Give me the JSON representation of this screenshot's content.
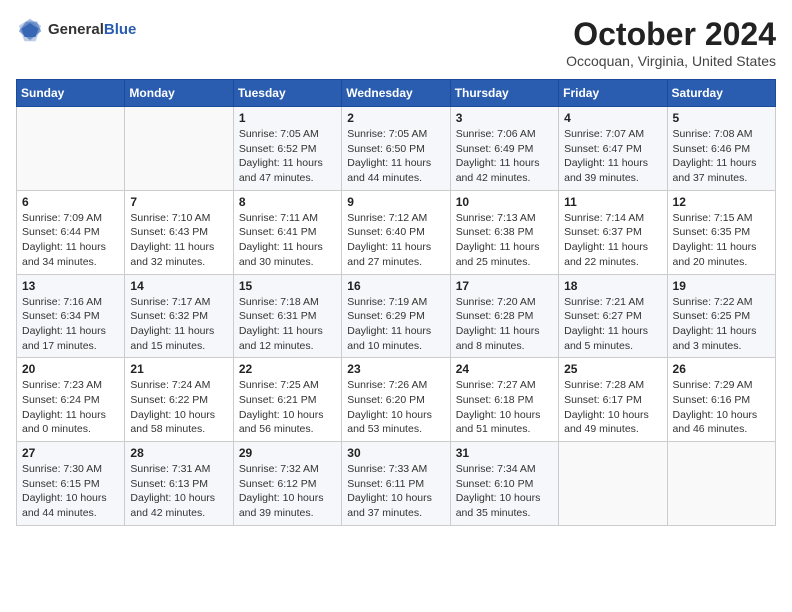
{
  "header": {
    "logo": {
      "text_general": "General",
      "text_blue": "Blue"
    },
    "month": "October 2024",
    "location": "Occoquan, Virginia, United States"
  },
  "weekdays": [
    "Sunday",
    "Monday",
    "Tuesday",
    "Wednesday",
    "Thursday",
    "Friday",
    "Saturday"
  ],
  "weeks": [
    [
      {
        "day": "",
        "info": ""
      },
      {
        "day": "",
        "info": ""
      },
      {
        "day": "1",
        "info": "Sunrise: 7:05 AM\nSunset: 6:52 PM\nDaylight: 11 hours and 47 minutes."
      },
      {
        "day": "2",
        "info": "Sunrise: 7:05 AM\nSunset: 6:50 PM\nDaylight: 11 hours and 44 minutes."
      },
      {
        "day": "3",
        "info": "Sunrise: 7:06 AM\nSunset: 6:49 PM\nDaylight: 11 hours and 42 minutes."
      },
      {
        "day": "4",
        "info": "Sunrise: 7:07 AM\nSunset: 6:47 PM\nDaylight: 11 hours and 39 minutes."
      },
      {
        "day": "5",
        "info": "Sunrise: 7:08 AM\nSunset: 6:46 PM\nDaylight: 11 hours and 37 minutes."
      }
    ],
    [
      {
        "day": "6",
        "info": "Sunrise: 7:09 AM\nSunset: 6:44 PM\nDaylight: 11 hours and 34 minutes."
      },
      {
        "day": "7",
        "info": "Sunrise: 7:10 AM\nSunset: 6:43 PM\nDaylight: 11 hours and 32 minutes."
      },
      {
        "day": "8",
        "info": "Sunrise: 7:11 AM\nSunset: 6:41 PM\nDaylight: 11 hours and 30 minutes."
      },
      {
        "day": "9",
        "info": "Sunrise: 7:12 AM\nSunset: 6:40 PM\nDaylight: 11 hours and 27 minutes."
      },
      {
        "day": "10",
        "info": "Sunrise: 7:13 AM\nSunset: 6:38 PM\nDaylight: 11 hours and 25 minutes."
      },
      {
        "day": "11",
        "info": "Sunrise: 7:14 AM\nSunset: 6:37 PM\nDaylight: 11 hours and 22 minutes."
      },
      {
        "day": "12",
        "info": "Sunrise: 7:15 AM\nSunset: 6:35 PM\nDaylight: 11 hours and 20 minutes."
      }
    ],
    [
      {
        "day": "13",
        "info": "Sunrise: 7:16 AM\nSunset: 6:34 PM\nDaylight: 11 hours and 17 minutes."
      },
      {
        "day": "14",
        "info": "Sunrise: 7:17 AM\nSunset: 6:32 PM\nDaylight: 11 hours and 15 minutes."
      },
      {
        "day": "15",
        "info": "Sunrise: 7:18 AM\nSunset: 6:31 PM\nDaylight: 11 hours and 12 minutes."
      },
      {
        "day": "16",
        "info": "Sunrise: 7:19 AM\nSunset: 6:29 PM\nDaylight: 11 hours and 10 minutes."
      },
      {
        "day": "17",
        "info": "Sunrise: 7:20 AM\nSunset: 6:28 PM\nDaylight: 11 hours and 8 minutes."
      },
      {
        "day": "18",
        "info": "Sunrise: 7:21 AM\nSunset: 6:27 PM\nDaylight: 11 hours and 5 minutes."
      },
      {
        "day": "19",
        "info": "Sunrise: 7:22 AM\nSunset: 6:25 PM\nDaylight: 11 hours and 3 minutes."
      }
    ],
    [
      {
        "day": "20",
        "info": "Sunrise: 7:23 AM\nSunset: 6:24 PM\nDaylight: 11 hours and 0 minutes."
      },
      {
        "day": "21",
        "info": "Sunrise: 7:24 AM\nSunset: 6:22 PM\nDaylight: 10 hours and 58 minutes."
      },
      {
        "day": "22",
        "info": "Sunrise: 7:25 AM\nSunset: 6:21 PM\nDaylight: 10 hours and 56 minutes."
      },
      {
        "day": "23",
        "info": "Sunrise: 7:26 AM\nSunset: 6:20 PM\nDaylight: 10 hours and 53 minutes."
      },
      {
        "day": "24",
        "info": "Sunrise: 7:27 AM\nSunset: 6:18 PM\nDaylight: 10 hours and 51 minutes."
      },
      {
        "day": "25",
        "info": "Sunrise: 7:28 AM\nSunset: 6:17 PM\nDaylight: 10 hours and 49 minutes."
      },
      {
        "day": "26",
        "info": "Sunrise: 7:29 AM\nSunset: 6:16 PM\nDaylight: 10 hours and 46 minutes."
      }
    ],
    [
      {
        "day": "27",
        "info": "Sunrise: 7:30 AM\nSunset: 6:15 PM\nDaylight: 10 hours and 44 minutes."
      },
      {
        "day": "28",
        "info": "Sunrise: 7:31 AM\nSunset: 6:13 PM\nDaylight: 10 hours and 42 minutes."
      },
      {
        "day": "29",
        "info": "Sunrise: 7:32 AM\nSunset: 6:12 PM\nDaylight: 10 hours and 39 minutes."
      },
      {
        "day": "30",
        "info": "Sunrise: 7:33 AM\nSunset: 6:11 PM\nDaylight: 10 hours and 37 minutes."
      },
      {
        "day": "31",
        "info": "Sunrise: 7:34 AM\nSunset: 6:10 PM\nDaylight: 10 hours and 35 minutes."
      },
      {
        "day": "",
        "info": ""
      },
      {
        "day": "",
        "info": ""
      }
    ]
  ]
}
